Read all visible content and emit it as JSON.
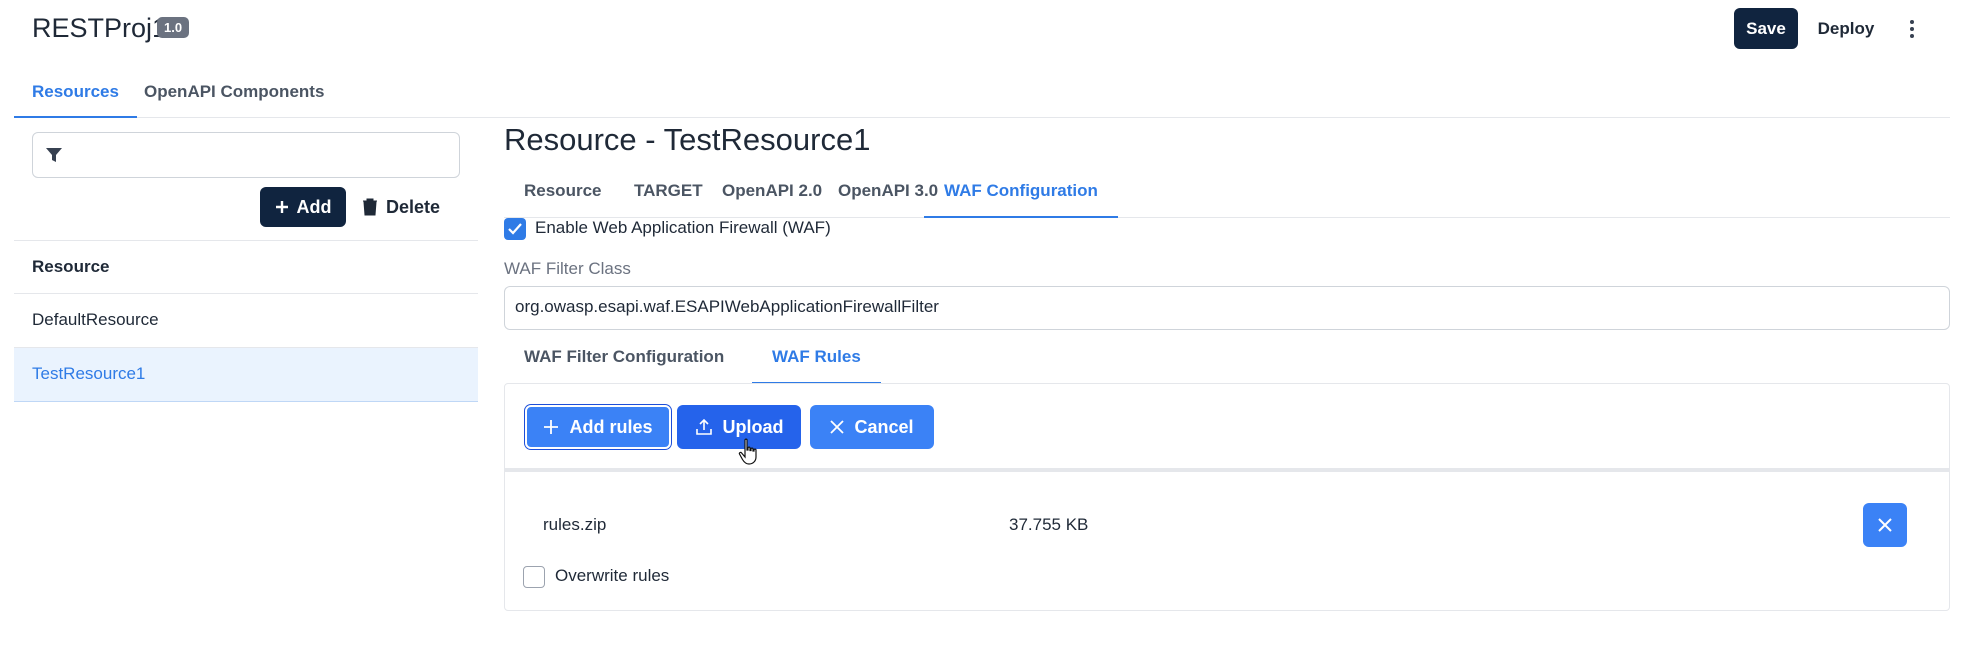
{
  "header": {
    "app_title": "RESTProj1",
    "version": "1.0",
    "save_label": "Save",
    "deploy_label": "Deploy",
    "more_icon": "kebab-menu-icon"
  },
  "top_tabs": [
    {
      "label": "Resources",
      "active": true
    },
    {
      "label": "OpenAPI Components",
      "active": false
    }
  ],
  "left_panel": {
    "filter": {
      "value": "",
      "placeholder": "",
      "icon": "filter-icon"
    },
    "add_label": "Add",
    "delete_label": "Delete",
    "list_header": "Resource",
    "items": [
      {
        "label": "DefaultResource",
        "selected": false
      },
      {
        "label": "TestResource1",
        "selected": true
      }
    ]
  },
  "main": {
    "title": "Resource - TestResource1",
    "tabs": [
      {
        "label": "Resource",
        "active": false
      },
      {
        "label": "TARGET",
        "active": false
      },
      {
        "label": "OpenAPI 2.0",
        "active": false
      },
      {
        "label": "OpenAPI 3.0",
        "active": false
      },
      {
        "label": "WAF Configuration",
        "active": true
      }
    ],
    "waf_enable": {
      "label": "Enable Web Application Firewall (WAF)",
      "checked": true
    },
    "waf_filter_class": {
      "label": "WAF Filter Class",
      "value": "org.owasp.esapi.waf.ESAPIWebApplicationFirewallFilter"
    },
    "inner_tabs": [
      {
        "label": "WAF Filter Configuration",
        "active": false
      },
      {
        "label": "WAF Rules",
        "active": true
      }
    ],
    "upload": {
      "add_rules_label": "Add rules",
      "upload_label": "Upload",
      "cancel_label": "Cancel",
      "file": {
        "name": "rules.zip",
        "size": "37.755 KB"
      },
      "overwrite": {
        "label": "Overwrite rules",
        "checked": false
      }
    }
  },
  "colors": {
    "accent": "#2f7be6",
    "primary_dark": "#10243f",
    "button_blue": "#3b82f6",
    "selected_bg": "#eaf3fe"
  }
}
